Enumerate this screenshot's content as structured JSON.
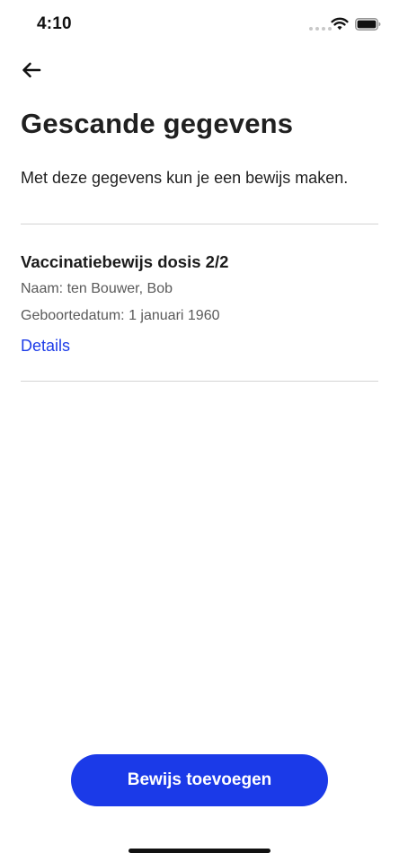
{
  "status_bar": {
    "time": "4:10"
  },
  "header": {
    "back_icon": "arrow-left-icon"
  },
  "main": {
    "title": "Gescande gegevens",
    "intro": "Met deze gegevens kun je een bewijs maken.",
    "proof": {
      "title": "Vaccinatiebewijs dosis 2/2",
      "name": "Naam: ten Bouwer, Bob",
      "birth_date": "Geboortedatum: 1 januari 1960",
      "details_label": "Details"
    }
  },
  "footer": {
    "primary_button_label": "Bewijs toevoegen"
  },
  "colors": {
    "accent": "#1b3ae8",
    "link": "#1d3ce8",
    "text": "#1b1b1b",
    "secondary_text": "#5a5a5a",
    "divider": "#d4d4d4"
  }
}
